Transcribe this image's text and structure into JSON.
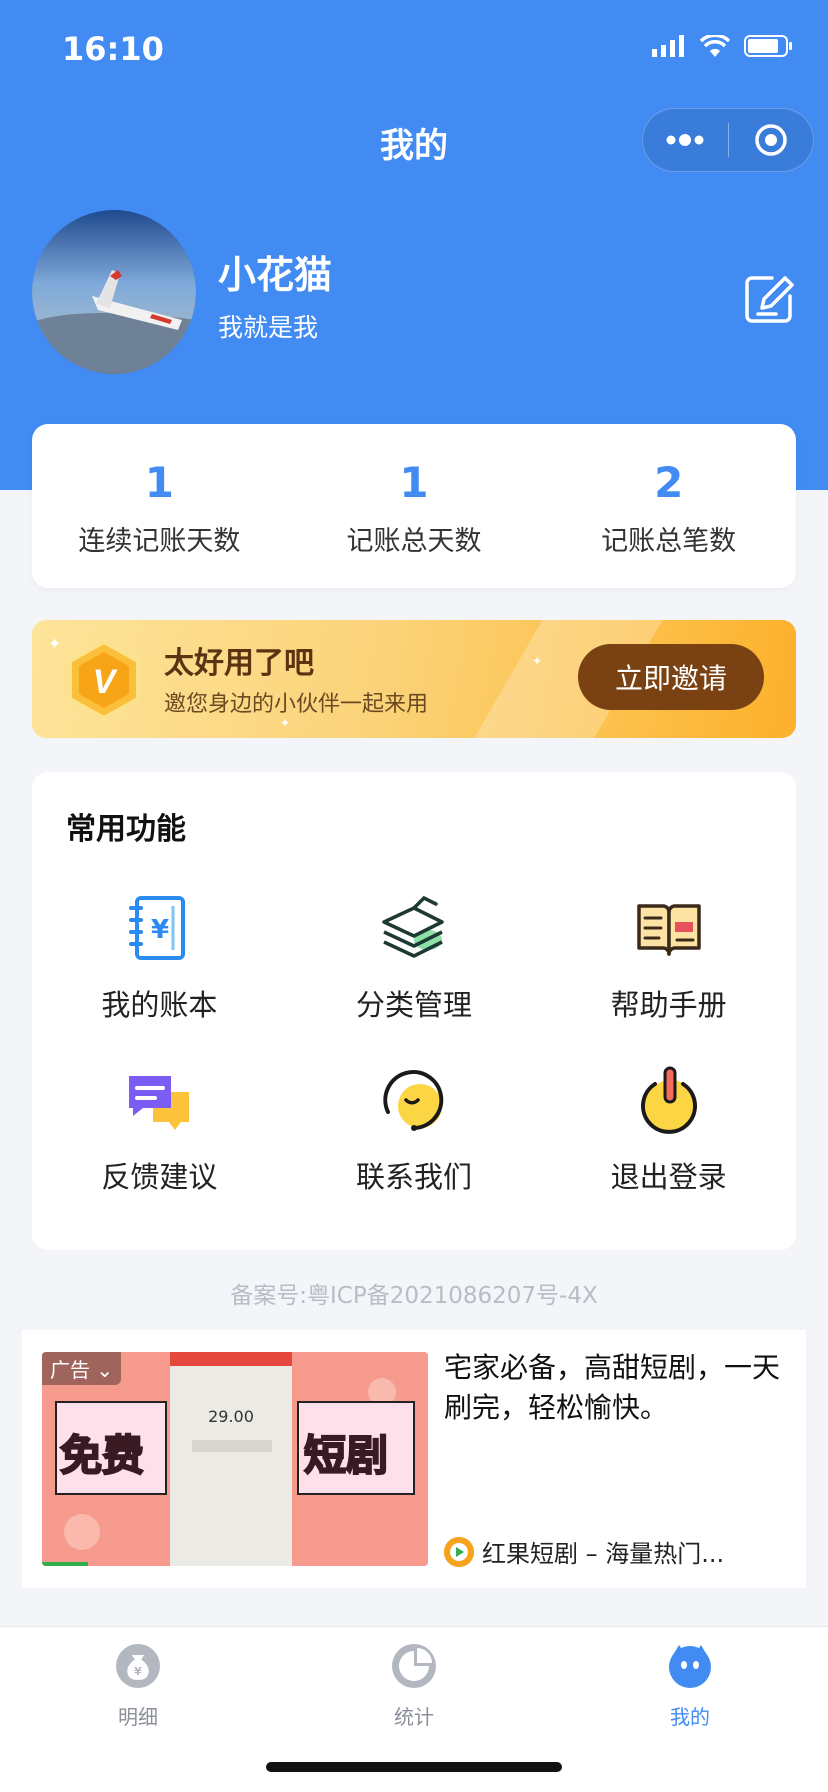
{
  "status_bar": {
    "time": "16:10"
  },
  "nav": {
    "title": "我的"
  },
  "profile": {
    "name": "小花猫",
    "signature": "我就是我"
  },
  "stats": [
    {
      "value": "1",
      "label": "连续记账天数"
    },
    {
      "value": "1",
      "label": "记账总天数"
    },
    {
      "value": "2",
      "label": "记账总笔数"
    }
  ],
  "invite": {
    "badge": "V",
    "title": "太好用了吧",
    "subtitle": "邀您身边的小伙伴一起来用",
    "button": "立即邀请"
  },
  "functions": {
    "title": "常用功能",
    "items": [
      {
        "label": "我的账本",
        "icon": "ledger-icon"
      },
      {
        "label": "分类管理",
        "icon": "category-icon"
      },
      {
        "label": "帮助手册",
        "icon": "help-book-icon"
      },
      {
        "label": "反馈建议",
        "icon": "feedback-icon"
      },
      {
        "label": "联系我们",
        "icon": "contact-icon"
      },
      {
        "label": "退出登录",
        "icon": "logout-icon"
      }
    ]
  },
  "icp": "备案号:粤ICP备2021086207号-4X",
  "ad": {
    "tag": "广告",
    "image_text_left": "免费",
    "image_text_right": "短剧",
    "text": "宅家必备，高甜短剧，一天刷完，轻松愉快。",
    "source": "红果短剧 – 海量热门..."
  },
  "tabbar": [
    {
      "label": "明细",
      "icon": "money-bag-icon",
      "active": false
    },
    {
      "label": "统计",
      "icon": "pie-chart-icon",
      "active": false
    },
    {
      "label": "我的",
      "icon": "profile-face-icon",
      "active": true
    }
  ],
  "colors": {
    "primary": "#418bf3",
    "invite_button": "#7a4112"
  }
}
